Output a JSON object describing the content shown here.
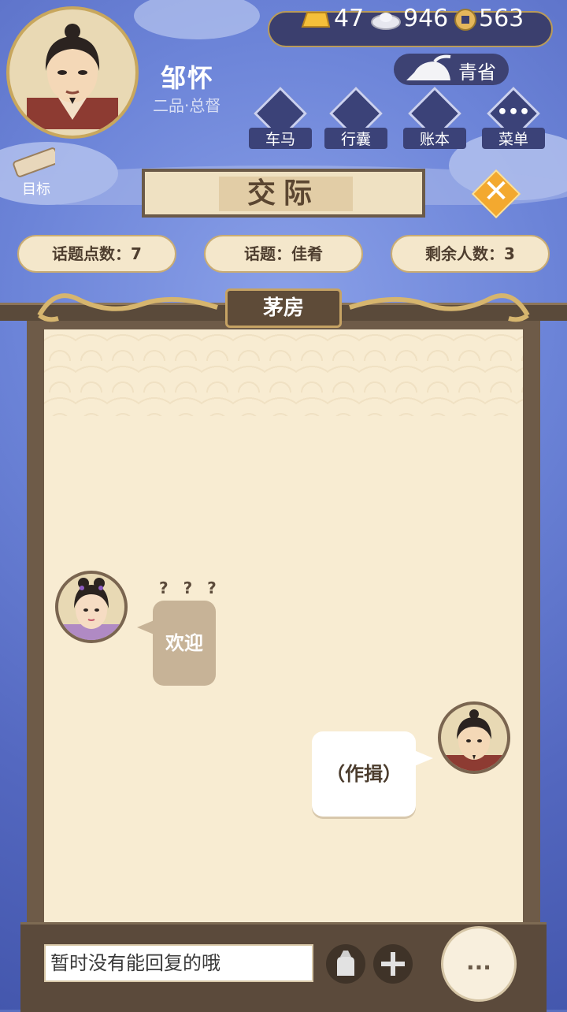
{
  "player": {
    "name": "邹怀",
    "rank": "二品·总督"
  },
  "resources": {
    "gold": "47",
    "silver": "946",
    "copper": "563"
  },
  "season": {
    "label": "青省"
  },
  "menu": {
    "items": [
      {
        "label": "车马",
        "icon": "carriage-icon"
      },
      {
        "label": "行囊",
        "icon": "bundle-icon"
      },
      {
        "label": "账本",
        "icon": "ledger-icon"
      },
      {
        "label": "菜单",
        "icon": "more-icon"
      }
    ],
    "target_label": "目标"
  },
  "title": "交际",
  "stats": {
    "topic_points": "话题点数：7",
    "topic": "话题：佳肴",
    "remaining": "剩余人数：3"
  },
  "room": "茅房",
  "chat": {
    "left_question": "? ? ?",
    "left_message": "欢迎",
    "right_message": "（作揖）"
  },
  "reply": {
    "text": "暂时没有能回复的哦",
    "more_label": "..."
  },
  "colors": {
    "background": "#5a6fbf",
    "paper": "#f8ecd2",
    "frame": "#6e5b48",
    "accent_gold": "#c8a75d",
    "close_orange": "#f3a92f"
  }
}
